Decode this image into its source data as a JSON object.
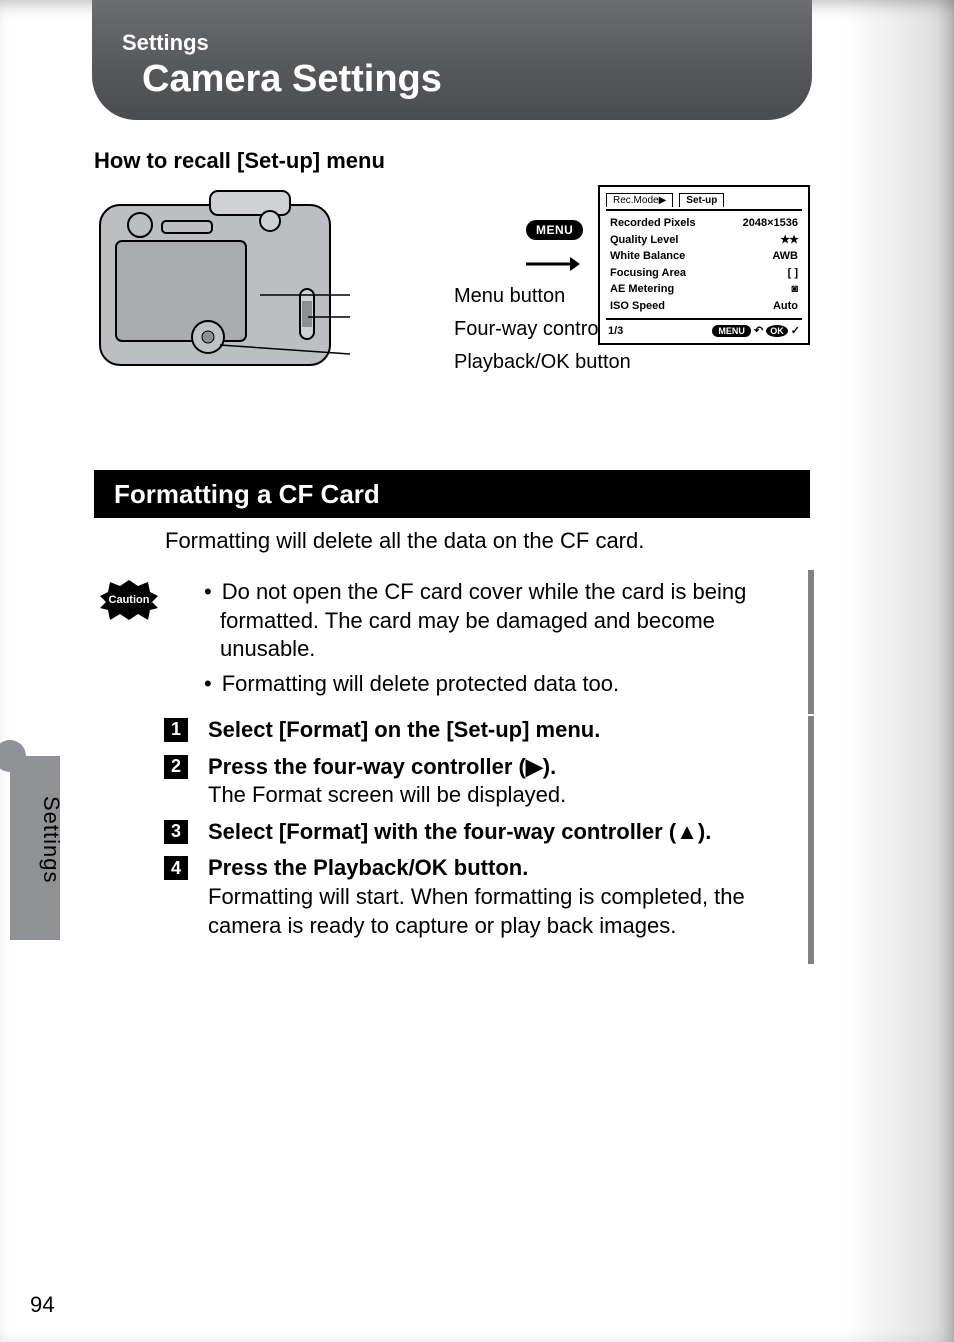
{
  "header": {
    "supertitle": "Settings",
    "title": "Camera Settings"
  },
  "sub1": "How to recall [Set-up] menu",
  "callouts": {
    "menu_button": "Menu button",
    "four_way": "Four-way controller",
    "playback_ok": "Playback/OK button"
  },
  "menu_icon_label": "MENU",
  "lcd": {
    "tabs": {
      "inactive": "Rec.Mode▶",
      "active": "Set-up"
    },
    "rows": [
      {
        "label": "Recorded Pixels",
        "value": "2048×1536"
      },
      {
        "label": "Quality Level",
        "value": "★★"
      },
      {
        "label": "White Balance",
        "value": "AWB"
      },
      {
        "label": "Focusing Area",
        "value": "[    ]"
      },
      {
        "label": "AE Metering",
        "value": "◙"
      },
      {
        "label": "ISO Speed",
        "value": "Auto"
      }
    ],
    "page_indicator": "1/3",
    "foot_menu": "MENU",
    "foot_undo": "↶",
    "foot_ok": "OK",
    "foot_check": "✓"
  },
  "section_bar": "Formatting a CF Card",
  "section_intro": "Formatting will delete all the data on the CF card.",
  "caution_label": "Caution",
  "cautions": [
    "Do not open the CF card cover while the card is being formatted. The card may be damaged and become unusable.",
    "Formatting will delete protected data too."
  ],
  "steps": [
    {
      "n": "1",
      "bold": "Select [Format] on the [Set-up] menu."
    },
    {
      "n": "2",
      "bold": "Press the four-way controller (▶).",
      "body": "The Format screen will be displayed."
    },
    {
      "n": "3",
      "bold": "Select [Format] with the four-way controller (▲)."
    },
    {
      "n": "4",
      "bold": "Press the Playback/OK button.",
      "body": "Formatting will start. When formatting is completed, the camera is ready to capture or play back images."
    }
  ],
  "side_tab": "Settings",
  "page_number": "94"
}
